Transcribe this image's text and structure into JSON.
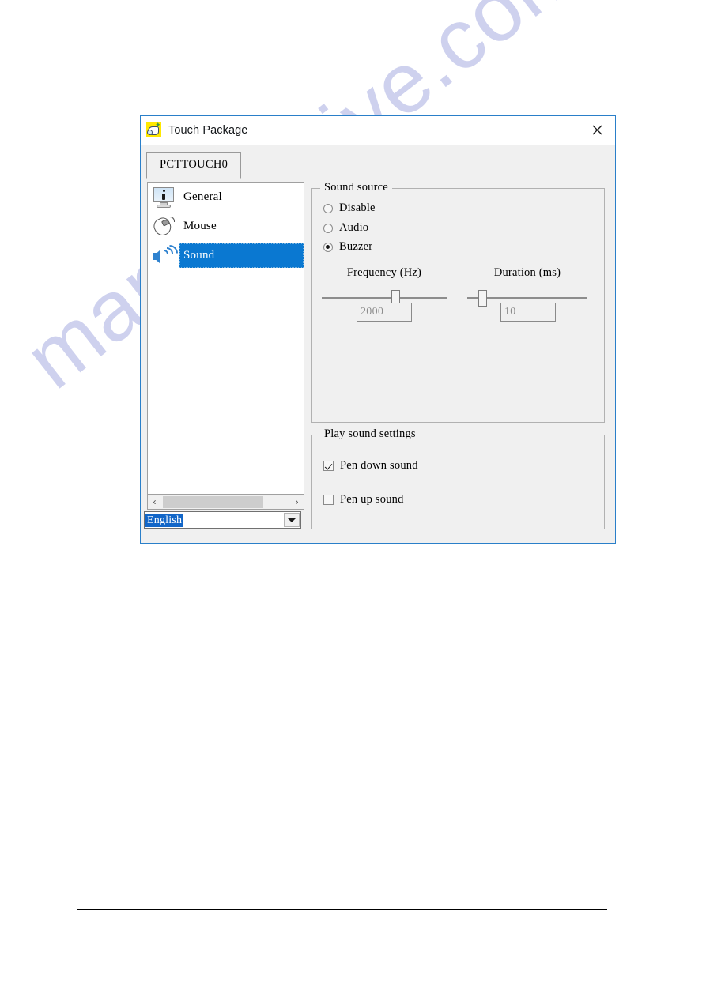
{
  "page": {
    "watermark": "manualshive.com"
  },
  "window": {
    "title": "Touch Package",
    "close_label": "✕",
    "icon": "touch-package-icon"
  },
  "tabs": [
    {
      "label": "PCTTOUCH0",
      "active": true
    }
  ],
  "sidebar": {
    "items": [
      {
        "label": "General",
        "icon": "monitor-info-icon",
        "selected": false
      },
      {
        "label": "Mouse",
        "icon": "mouse-icon",
        "selected": false
      },
      {
        "label": "Sound",
        "icon": "speaker-icon",
        "selected": true
      }
    ],
    "scrollbar": {
      "left_arrow": "‹",
      "right_arrow": "›"
    },
    "language": {
      "value": "English"
    }
  },
  "sound_source": {
    "legend": "Sound source",
    "options": [
      {
        "label": "Disable",
        "selected": false
      },
      {
        "label": "Audio",
        "selected": false
      },
      {
        "label": "Buzzer",
        "selected": true
      }
    ],
    "frequency": {
      "label": "Frequency (Hz)",
      "value": "2000",
      "thumb_percent": 60
    },
    "duration": {
      "label": "Duration (ms)",
      "value": "10",
      "thumb_percent": 10
    }
  },
  "play_sound_settings": {
    "legend": "Play sound settings",
    "options": [
      {
        "label": "Pen down sound",
        "checked": true
      },
      {
        "label": "Pen up sound",
        "checked": false
      }
    ]
  },
  "colors": {
    "selection_blue": "#0a78d1",
    "window_border": "#2a7fc9",
    "dialog_face": "#f0f0f0",
    "watermark": "#bcc0e8"
  }
}
